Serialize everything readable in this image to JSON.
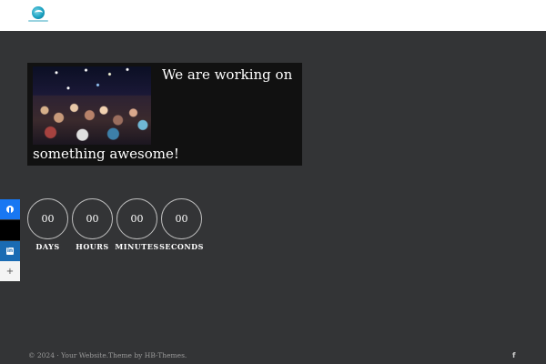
{
  "header": {
    "logo_icon": "wave-logo-icon"
  },
  "hero": {
    "line1": "We are working on",
    "line2": "something awesome!",
    "image": "concert-crowd-photo"
  },
  "countdown": [
    {
      "value": "00",
      "label": "DAYS"
    },
    {
      "value": "00",
      "label": "HOURS"
    },
    {
      "value": "00",
      "label": "MINUTES"
    },
    {
      "value": "00",
      "label": "SECONDS"
    }
  ],
  "share_bar": {
    "items": [
      {
        "icon": "facebook-icon",
        "color": "#1877f2"
      },
      {
        "icon": "x-icon",
        "color": "#000000"
      },
      {
        "icon": "linkedin-icon",
        "color": "#1a6bb3"
      },
      {
        "icon": "plus-icon",
        "glyph": "+",
        "color": "#f4f4f4"
      }
    ]
  },
  "footer": {
    "text": "© 2024 · Your Website.Theme by HB-Themes.",
    "facebook_glyph": "f"
  },
  "colors": {
    "background": "#333436",
    "header": "#ffffff",
    "hero_box": "#111111"
  }
}
